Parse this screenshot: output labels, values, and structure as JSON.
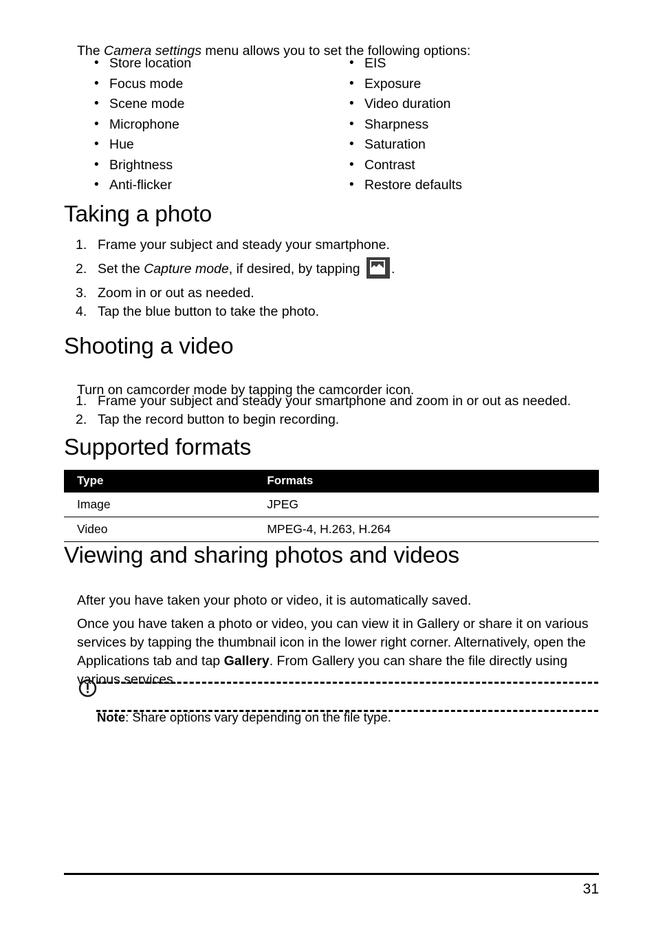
{
  "document": {
    "page_number": "31"
  },
  "intro": {
    "before_italic": "The ",
    "italic": "Camera settings",
    "after_italic": " menu allows you to set the following options:"
  },
  "settings_options": {
    "left_column": [
      "Store location",
      "Focus mode",
      "Scene mode",
      "Microphone",
      "Hue",
      "Brightness",
      "Anti-flicker"
    ],
    "right_column": [
      "EIS",
      "Exposure",
      "Video duration",
      "Sharpness",
      "Saturation",
      "Contrast",
      "Restore defaults"
    ]
  },
  "taking_a_photo": {
    "heading": "Taking a photo",
    "steps": [
      {
        "num": "1.",
        "text": "Frame your subject and steady your smartphone."
      },
      {
        "num": "2.",
        "before_italic": "Set the ",
        "italic": "Capture mode",
        "after_italic": ", if desired, by tapping ",
        "icon": "capture-mode-icon",
        "trailing": "."
      },
      {
        "num": "3.",
        "text": "Zoom in or out as needed."
      },
      {
        "num": "4.",
        "text": "Tap the blue button to take the photo."
      }
    ]
  },
  "shooting_a_video": {
    "heading": "Shooting a video",
    "intro": "Turn on camcorder mode by tapping the camcorder icon.",
    "steps": [
      {
        "num": "1.",
        "text": "Frame your subject and steady your smartphone and zoom in or out as needed."
      },
      {
        "num": "2.",
        "text": "Tap the record button to begin recording."
      }
    ]
  },
  "supported_formats": {
    "heading": "Supported formats",
    "columns": [
      "Type",
      "Formats"
    ],
    "rows": [
      [
        "Image",
        "JPEG"
      ],
      [
        "Video",
        "MPEG-4, H.263, H.264"
      ]
    ]
  },
  "viewing_sharing": {
    "heading": "Viewing and sharing photos and videos",
    "paragraph_1": "After you have taken your photo or video, it is automatically saved.",
    "paragraph_2": {
      "part_1": "Once you have taken a photo or video, you can view it in Gallery or share it on various services by tapping the thumbnail icon in the lower right corner. Alternatively, open the Applications tab and tap ",
      "bold": "Gallery",
      "part_2": ". From Gallery you can share the file directly using various services."
    }
  },
  "note": {
    "label": "Note",
    "text": ": Share options vary depending on the file type."
  },
  "colors": {
    "table_header_bg": "#000000",
    "table_header_text": "#ffffff",
    "icon_bg": "#3e3e3e",
    "text": "#000000"
  }
}
